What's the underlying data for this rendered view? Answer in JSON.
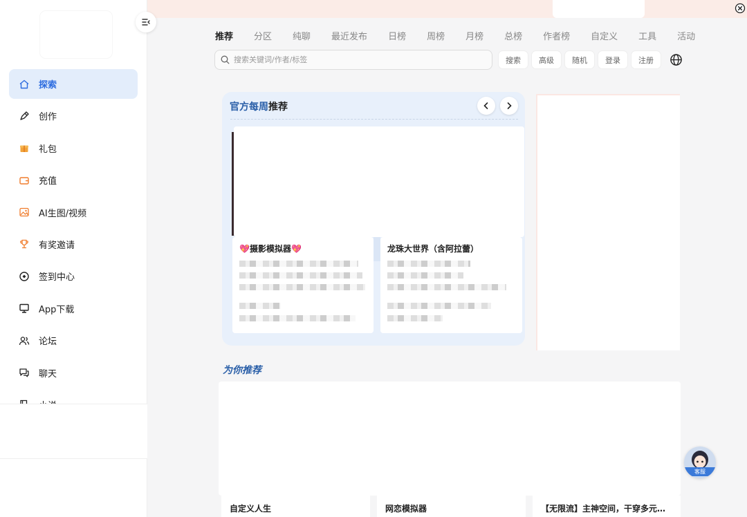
{
  "sidebar": {
    "items": [
      {
        "label": "探索",
        "icon": "home-icon",
        "active": true
      },
      {
        "label": "创作",
        "icon": "pen-icon"
      },
      {
        "label": "礼包",
        "icon": "gift-icon"
      },
      {
        "label": "充值",
        "icon": "wallet-icon"
      },
      {
        "label": "AI生图/视频",
        "icon": "image-icon"
      },
      {
        "label": "有奖邀请",
        "icon": "trophy-icon"
      },
      {
        "label": "签到中心",
        "icon": "checkin-icon"
      },
      {
        "label": "App下载",
        "icon": "monitor-icon"
      },
      {
        "label": "论坛",
        "icon": "users-icon"
      },
      {
        "label": "聊天",
        "icon": "chat-icon"
      },
      {
        "label": "小说",
        "icon": "book-icon"
      }
    ]
  },
  "tabs": [
    "推荐",
    "分区",
    "纯聊",
    "最近发布",
    "日榜",
    "周榜",
    "月榜",
    "总榜",
    "作者榜",
    "自定义",
    "工具",
    "活动"
  ],
  "search": {
    "placeholder": "搜索关键词/作者/标签",
    "search_label": "搜索",
    "advanced_label": "高级",
    "random_label": "随机",
    "login_label": "登录",
    "register_label": "注册"
  },
  "weekly": {
    "title_blue": "官方每周",
    "title_dark": "推荐",
    "cards": [
      {
        "title": "💖摄影模拟器💖"
      },
      {
        "title": "龙珠大世界（含阿拉蕾）"
      }
    ]
  },
  "foryou": {
    "title": "为你推荐",
    "cards": [
      {
        "title": "自定义人生"
      },
      {
        "title": "网恋模拟器"
      },
      {
        "title": "【无限流】主神空间，干穿多元…"
      }
    ]
  },
  "service": {
    "label": "客服"
  },
  "colors": {
    "accent": "#2d6cdf",
    "active_bg": "#e3edfb",
    "banner": "#fbece7"
  }
}
